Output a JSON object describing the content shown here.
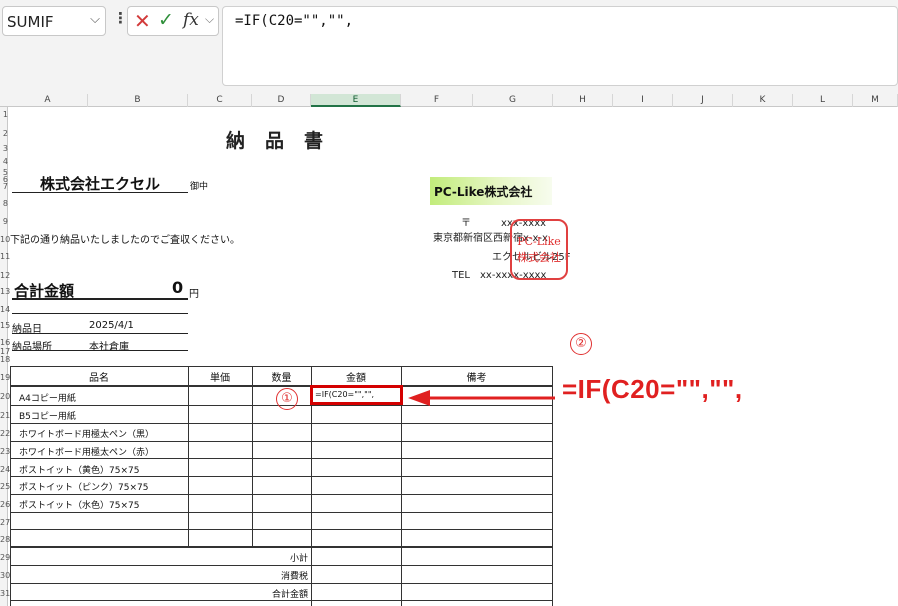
{
  "toolbar": {
    "name_box": "SUMIF",
    "cancel_glyph": "✕",
    "enter_glyph": "✓",
    "fx_label": "fx",
    "formula_text": "=IF(C20=\"\",\"\","
  },
  "columns": [
    "A",
    "B",
    "C",
    "D",
    "E",
    "F",
    "G",
    "H",
    "I",
    "J",
    "K",
    "L",
    "M"
  ],
  "rows": [
    "1",
    "2",
    "3",
    "4",
    "5",
    "6",
    "7",
    "8",
    "9",
    "10",
    "11",
    "12",
    "13",
    "14",
    "15",
    "16",
    "17",
    "18",
    "19",
    "20",
    "21",
    "22",
    "23",
    "24",
    "25",
    "26",
    "27",
    "28",
    "29",
    "30",
    "31"
  ],
  "doc": {
    "title": "納品書",
    "customer": "株式会社エクセル",
    "honorific": "御中",
    "notice": "下記の通り納品いたしましたのでご査収ください。",
    "total_label": "合計金額",
    "total_value": "0",
    "total_unit": "円",
    "delivery_date_label": "納品日",
    "delivery_date": "2025/4/1",
    "delivery_place_label": "納品場所",
    "delivery_place": "本社倉庫"
  },
  "sender": {
    "logo": "PC-Like株式会社",
    "postal": "〒　　　xxx-xxxx",
    "address1": "東京都新宿区西新宿x-x-x",
    "address2": "エクセルビル25F",
    "tel": "TEL　xx-xxxx-xxxx",
    "stamp_line1": "PC-Like",
    "stamp_line2": "株式会社"
  },
  "table": {
    "headers": [
      "品名",
      "単価",
      "数量",
      "金額",
      "備考"
    ],
    "items": [
      "A4コピー用紙",
      "B5コピー用紙",
      "ホワイトボード用極太ペン（黒）",
      "ホワイトボード用極太ペン（赤）",
      "ポストイット（黄色）75×75",
      "ポストイット（ピンク）75×75",
      "ポストイット（水色）75×75"
    ],
    "active_cell_text": "=IF(C20=\"\",\"\",",
    "subtotal_label": "小計",
    "tax_label": "消費税",
    "grand_total_label": "合計金額"
  },
  "annotations": {
    "marker1": "①",
    "marker2": "②",
    "big_formula": "=IF(C20=\"\",\"\",",
    "accent_color": "#e02020"
  }
}
